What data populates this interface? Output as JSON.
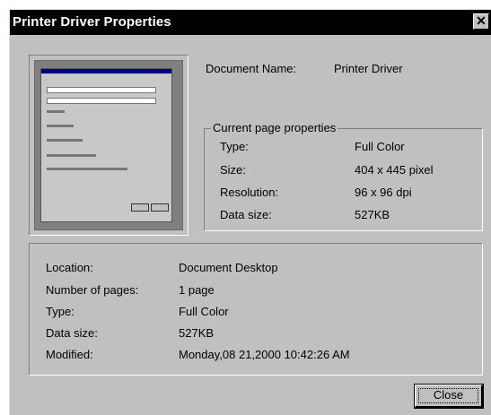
{
  "window": {
    "title": "Printer Driver Properties",
    "close_glyph": "✕"
  },
  "document_name": {
    "label": "Document Name:",
    "value": "Printer Driver"
  },
  "current_page": {
    "legend": "Current page properties",
    "rows": [
      {
        "label": "Type:",
        "value": "Full Color"
      },
      {
        "label": "Size:",
        "value": "404 x 445 pixel"
      },
      {
        "label": "Resolution:",
        "value": "96 x 96 dpi"
      },
      {
        "label": "Data size:",
        "value": "527KB"
      }
    ]
  },
  "document_info": {
    "rows": [
      {
        "label": "Location:",
        "value": "Document Desktop"
      },
      {
        "label": "Number of pages:",
        "value": "1 page"
      },
      {
        "label": "Type:",
        "value": "Full Color"
      },
      {
        "label": "Data size:",
        "value": "527KB"
      },
      {
        "label": "Modified:",
        "value": "Monday,08 21,2000 10:42:26 AM"
      }
    ]
  },
  "buttons": {
    "close_label": "Close"
  }
}
